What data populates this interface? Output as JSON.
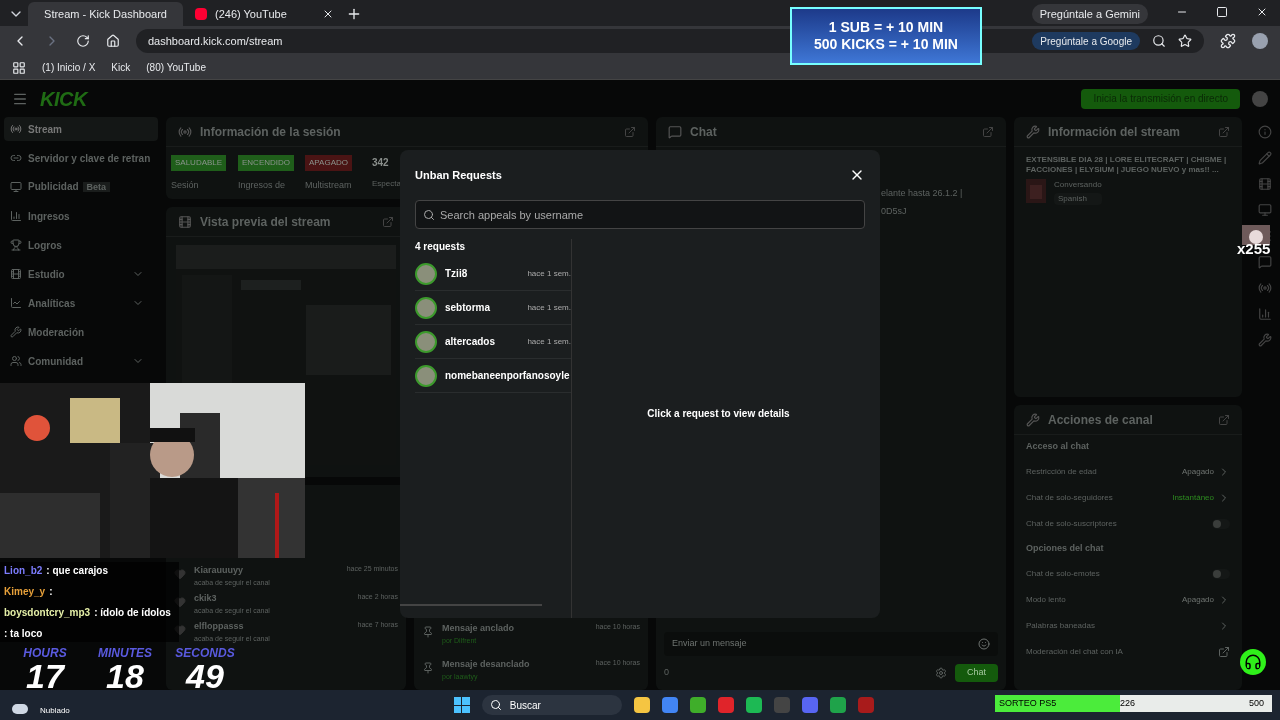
{
  "browser": {
    "tabs": [
      {
        "title": "Stream - Kick Dashboard",
        "selected": true
      },
      {
        "title": "(246) YouTube",
        "selected": false
      }
    ],
    "gemini_button": "Pregúntale a Gemini",
    "url": "dashboard.kick.com/stream",
    "google_button": "Pregúntale a Google",
    "bookmarks": [
      "(1) Inicio / X",
      "Kick",
      "(80) YouTube"
    ]
  },
  "dashboard": {
    "logo": "KICK",
    "go_live_button": "Inicia la transmisión en directo",
    "sidebar": {
      "items": [
        {
          "label": "Stream",
          "selected": true,
          "expandable": false
        },
        {
          "label": "Servidor y clave de retran",
          "selected": false,
          "expandable": false
        },
        {
          "label": "Publicidad",
          "badge": "Beta",
          "selected": false,
          "expandable": false
        },
        {
          "label": "Ingresos",
          "selected": false,
          "expandable": false
        },
        {
          "label": "Logros",
          "selected": false,
          "expandable": false
        },
        {
          "label": "Estudio",
          "selected": false,
          "expandable": true
        },
        {
          "label": "Analíticas",
          "selected": false,
          "expandable": true
        },
        {
          "label": "Moderación",
          "selected": false,
          "expandable": false
        },
        {
          "label": "Comunidad",
          "selected": false,
          "expandable": true
        }
      ]
    },
    "session": {
      "title": "Información de la sesión",
      "statuses": [
        {
          "label": "SALUDABLE",
          "caption": "Sesión",
          "color": "#1f5e1a"
        },
        {
          "label": "ENCENDIDO",
          "caption": "Ingresos de",
          "color": "#1f5e1a"
        },
        {
          "label": "APAGADO",
          "caption": "Multistream",
          "color": "#4a1414"
        }
      ],
      "viewers": "342",
      "viewers_caption": "Especta"
    },
    "preview": {
      "title": "Vista previa del stream"
    },
    "activity": [
      {
        "name": "Kiarauuuyy",
        "action": "acaba de seguir el canal",
        "time": "hace 25 minutos"
      },
      {
        "name": "ckik3",
        "action": "acaba de seguir el canal",
        "time": "hace 2 horas"
      },
      {
        "name": "elfloppasss",
        "action": "acaba de seguir el canal",
        "time": "hace 7 horas"
      }
    ],
    "pinned_log": [
      {
        "title": "Mensaje anclado",
        "by": "por Dilfrent",
        "time": "hace 10 horas"
      },
      {
        "title": "Mensaje desanclado",
        "by": "por laawtyy",
        "time": "hace 10 horas"
      }
    ],
    "chat": {
      "title": "Chat",
      "pinned_lines": [
        "elante hasta 26.1.2 |",
        "0D5sJ"
      ],
      "input_placeholder": "Enviar un mensaje",
      "count": "0",
      "send_button": "Chat"
    },
    "stream_info": {
      "title": "Información del stream",
      "stream_title": "EXTENSIBLE DIA 28 | LORE ELITECRAFT | CHISME | FACCIONES | ELYSIUM | JUEGO NUEVO y mas!! ...",
      "category": "Conversando",
      "tag": "Spanish"
    },
    "channel_actions": {
      "title": "Acciones de canal",
      "sections": [
        {
          "heading": "Acceso al chat",
          "rows": [
            {
              "kind": "value",
              "label": "Restricción de edad",
              "value": "Apagado",
              "active": false
            },
            {
              "kind": "value",
              "label": "Chat de solo-seguidores",
              "value": "Instantáneo",
              "active": true
            },
            {
              "kind": "toggle",
              "label": "Chat de solo-suscriptores",
              "on": false
            }
          ]
        },
        {
          "heading": "Opciones del chat",
          "rows": [
            {
              "kind": "toggle",
              "label": "Chat de solo-emotes",
              "on": false
            },
            {
              "kind": "value",
              "label": "Modo lento",
              "value": "Apagado",
              "active": false
            },
            {
              "kind": "link",
              "label": "Palabras baneadas"
            },
            {
              "kind": "external",
              "label": "Moderación del chat con IA"
            }
          ]
        }
      ]
    }
  },
  "modal": {
    "title": "Unban Requests",
    "search_placeholder": "Search appeals by username",
    "count": "4 requests",
    "requests": [
      {
        "name": "Tzii8",
        "time": "hace 1 sem."
      },
      {
        "name": "sebtorma",
        "time": "hace 1 sem."
      },
      {
        "name": "altercados",
        "time": "hace 1 sem."
      },
      {
        "name": "nomebaneenporfanosoyle"
      }
    ],
    "empty_message": "Click a request to view details"
  },
  "overlay": {
    "banner": [
      "1 SUB = + 10 MIN",
      "500 KICKS = + 10 MIN"
    ],
    "emote_count": "x255",
    "chat": [
      {
        "user": "Lion_b2",
        "message": ": que carajos",
        "color": "#7d7dff"
      },
      {
        "user": "Kimey_y",
        "message": ":",
        "color": "#e8a13a"
      },
      {
        "user": "boysdontcry_mp3",
        "message": ": ídolo de ídolos",
        "color": "#e6f0a8"
      },
      {
        "message": ": ta loco"
      }
    ],
    "timer": [
      {
        "label": "HOURS",
        "value": "17"
      },
      {
        "label": "MINUTES",
        "value": "18"
      },
      {
        "label": "SECONDS",
        "value": "49"
      }
    ],
    "giveaway": {
      "label": "SORTEO PS5",
      "current": "226",
      "goal": "500",
      "level": 0.45
    }
  },
  "taskbar": {
    "weather": "Nublado",
    "search_placeholder": "Buscar"
  }
}
